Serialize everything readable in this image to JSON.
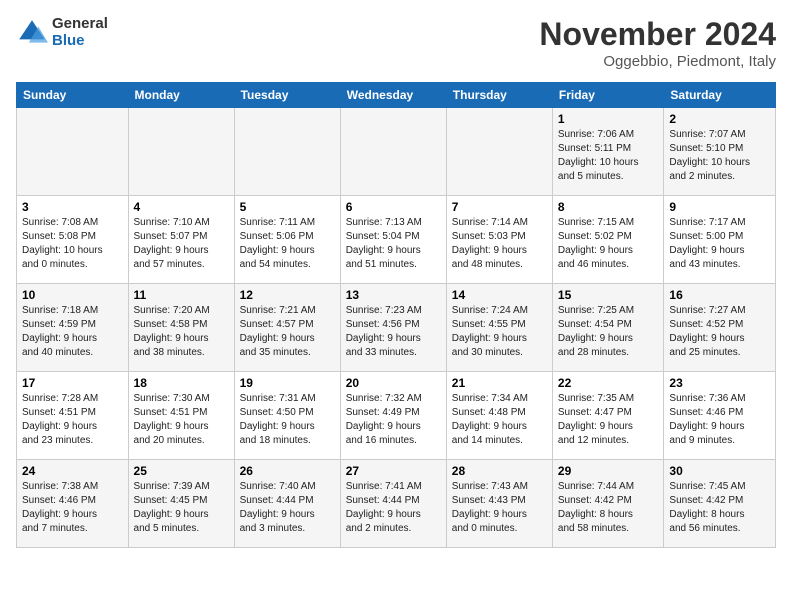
{
  "logo": {
    "general": "General",
    "blue": "Blue"
  },
  "title": "November 2024",
  "location": "Oggebbio, Piedmont, Italy",
  "weekdays": [
    "Sunday",
    "Monday",
    "Tuesday",
    "Wednesday",
    "Thursday",
    "Friday",
    "Saturday"
  ],
  "weeks": [
    [
      {
        "day": "",
        "info": ""
      },
      {
        "day": "",
        "info": ""
      },
      {
        "day": "",
        "info": ""
      },
      {
        "day": "",
        "info": ""
      },
      {
        "day": "",
        "info": ""
      },
      {
        "day": "1",
        "info": "Sunrise: 7:06 AM\nSunset: 5:11 PM\nDaylight: 10 hours\nand 5 minutes."
      },
      {
        "day": "2",
        "info": "Sunrise: 7:07 AM\nSunset: 5:10 PM\nDaylight: 10 hours\nand 2 minutes."
      }
    ],
    [
      {
        "day": "3",
        "info": "Sunrise: 7:08 AM\nSunset: 5:08 PM\nDaylight: 10 hours\nand 0 minutes."
      },
      {
        "day": "4",
        "info": "Sunrise: 7:10 AM\nSunset: 5:07 PM\nDaylight: 9 hours\nand 57 minutes."
      },
      {
        "day": "5",
        "info": "Sunrise: 7:11 AM\nSunset: 5:06 PM\nDaylight: 9 hours\nand 54 minutes."
      },
      {
        "day": "6",
        "info": "Sunrise: 7:13 AM\nSunset: 5:04 PM\nDaylight: 9 hours\nand 51 minutes."
      },
      {
        "day": "7",
        "info": "Sunrise: 7:14 AM\nSunset: 5:03 PM\nDaylight: 9 hours\nand 48 minutes."
      },
      {
        "day": "8",
        "info": "Sunrise: 7:15 AM\nSunset: 5:02 PM\nDaylight: 9 hours\nand 46 minutes."
      },
      {
        "day": "9",
        "info": "Sunrise: 7:17 AM\nSunset: 5:00 PM\nDaylight: 9 hours\nand 43 minutes."
      }
    ],
    [
      {
        "day": "10",
        "info": "Sunrise: 7:18 AM\nSunset: 4:59 PM\nDaylight: 9 hours\nand 40 minutes."
      },
      {
        "day": "11",
        "info": "Sunrise: 7:20 AM\nSunset: 4:58 PM\nDaylight: 9 hours\nand 38 minutes."
      },
      {
        "day": "12",
        "info": "Sunrise: 7:21 AM\nSunset: 4:57 PM\nDaylight: 9 hours\nand 35 minutes."
      },
      {
        "day": "13",
        "info": "Sunrise: 7:23 AM\nSunset: 4:56 PM\nDaylight: 9 hours\nand 33 minutes."
      },
      {
        "day": "14",
        "info": "Sunrise: 7:24 AM\nSunset: 4:55 PM\nDaylight: 9 hours\nand 30 minutes."
      },
      {
        "day": "15",
        "info": "Sunrise: 7:25 AM\nSunset: 4:54 PM\nDaylight: 9 hours\nand 28 minutes."
      },
      {
        "day": "16",
        "info": "Sunrise: 7:27 AM\nSunset: 4:52 PM\nDaylight: 9 hours\nand 25 minutes."
      }
    ],
    [
      {
        "day": "17",
        "info": "Sunrise: 7:28 AM\nSunset: 4:51 PM\nDaylight: 9 hours\nand 23 minutes."
      },
      {
        "day": "18",
        "info": "Sunrise: 7:30 AM\nSunset: 4:51 PM\nDaylight: 9 hours\nand 20 minutes."
      },
      {
        "day": "19",
        "info": "Sunrise: 7:31 AM\nSunset: 4:50 PM\nDaylight: 9 hours\nand 18 minutes."
      },
      {
        "day": "20",
        "info": "Sunrise: 7:32 AM\nSunset: 4:49 PM\nDaylight: 9 hours\nand 16 minutes."
      },
      {
        "day": "21",
        "info": "Sunrise: 7:34 AM\nSunset: 4:48 PM\nDaylight: 9 hours\nand 14 minutes."
      },
      {
        "day": "22",
        "info": "Sunrise: 7:35 AM\nSunset: 4:47 PM\nDaylight: 9 hours\nand 12 minutes."
      },
      {
        "day": "23",
        "info": "Sunrise: 7:36 AM\nSunset: 4:46 PM\nDaylight: 9 hours\nand 9 minutes."
      }
    ],
    [
      {
        "day": "24",
        "info": "Sunrise: 7:38 AM\nSunset: 4:46 PM\nDaylight: 9 hours\nand 7 minutes."
      },
      {
        "day": "25",
        "info": "Sunrise: 7:39 AM\nSunset: 4:45 PM\nDaylight: 9 hours\nand 5 minutes."
      },
      {
        "day": "26",
        "info": "Sunrise: 7:40 AM\nSunset: 4:44 PM\nDaylight: 9 hours\nand 3 minutes."
      },
      {
        "day": "27",
        "info": "Sunrise: 7:41 AM\nSunset: 4:44 PM\nDaylight: 9 hours\nand 2 minutes."
      },
      {
        "day": "28",
        "info": "Sunrise: 7:43 AM\nSunset: 4:43 PM\nDaylight: 9 hours\nand 0 minutes."
      },
      {
        "day": "29",
        "info": "Sunrise: 7:44 AM\nSunset: 4:42 PM\nDaylight: 8 hours\nand 58 minutes."
      },
      {
        "day": "30",
        "info": "Sunrise: 7:45 AM\nSunset: 4:42 PM\nDaylight: 8 hours\nand 56 minutes."
      }
    ]
  ]
}
